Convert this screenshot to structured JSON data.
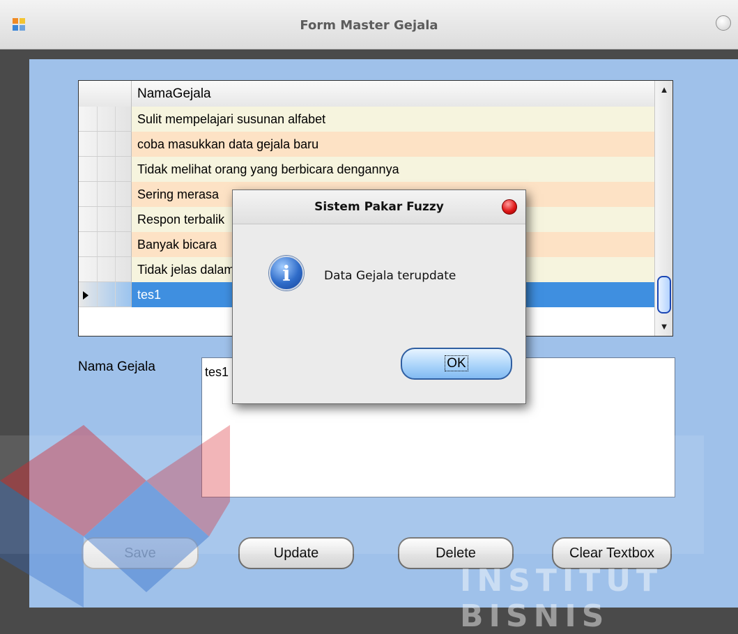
{
  "window": {
    "title": "Form Master Gejala"
  },
  "grid": {
    "column_header": "NamaGejala",
    "rows": [
      {
        "value": "Sulit mempelajari susunan alfabet",
        "selected": false
      },
      {
        "value": "coba masukkan data gejala baru",
        "selected": false
      },
      {
        "value": "Tidak melihat orang yang berbicara dengannya",
        "selected": false
      },
      {
        "value": "Sering merasa",
        "selected": false
      },
      {
        "value": "Respon terbalik",
        "selected": false
      },
      {
        "value": "Banyak bicara",
        "selected": false
      },
      {
        "value": "Tidak jelas dalam",
        "selected": false
      },
      {
        "value": "tes1",
        "selected": true
      }
    ]
  },
  "form": {
    "label": "Nama Gejala",
    "textbox_value": "tes1"
  },
  "buttons": {
    "save": "Save",
    "update": "Update",
    "delete": "Delete",
    "clear": "Clear Textbox"
  },
  "dialog": {
    "title": "Sistem Pakar Fuzzy",
    "message": "Data Gejala terupdate",
    "ok": "OK"
  },
  "watermark": {
    "text": "INSTITUT BISNIS"
  },
  "colors": {
    "client_bg": "#9fc1ea",
    "row_odd": "#f6f4de",
    "row_even": "#fde2c5",
    "row_selected": "#3f8fe0"
  }
}
